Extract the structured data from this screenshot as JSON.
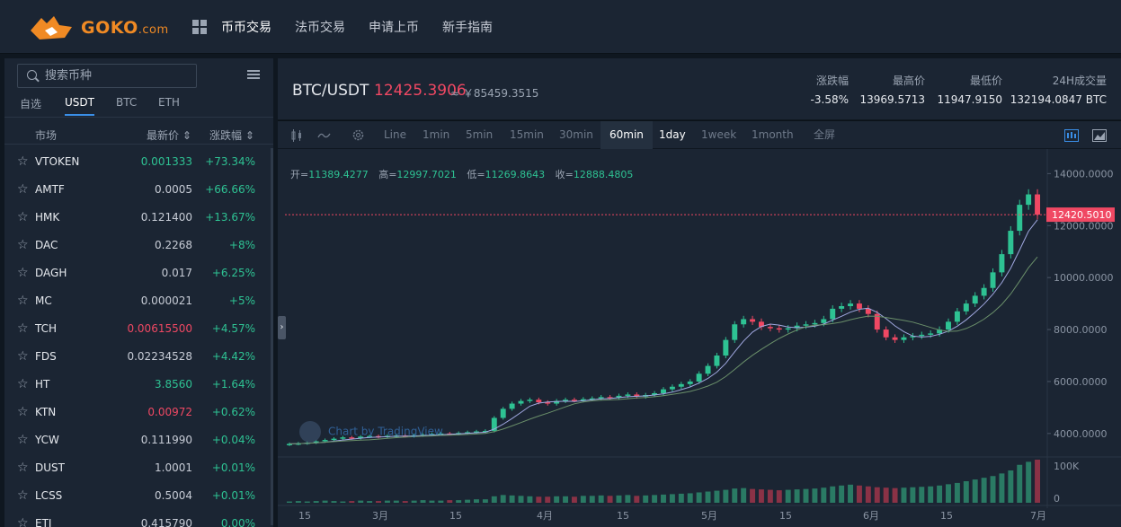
{
  "header": {
    "logo_text": "GOKO",
    "logo_suffix": ".com",
    "nav": [
      "币币交易",
      "法币交易",
      "申请上币",
      "新手指南"
    ]
  },
  "sidebar": {
    "search_placeholder": "搜索币种",
    "tabs": [
      "自选",
      "USDT",
      "BTC",
      "ETH"
    ],
    "columns": {
      "market": "市场",
      "price": "最新价 ⇕",
      "change": "涨跌幅 ⇕"
    },
    "rows": [
      {
        "symbol": "VTOKEN",
        "price": "0.001333",
        "change": "+73.34%",
        "price_color": "green"
      },
      {
        "symbol": "AMTF",
        "price": "0.0005",
        "change": "+66.66%",
        "price_color": "gray"
      },
      {
        "symbol": "HMK",
        "price": "0.121400",
        "change": "+13.67%",
        "price_color": "gray"
      },
      {
        "symbol": "DAC",
        "price": "0.2268",
        "change": "+8%",
        "price_color": "gray"
      },
      {
        "symbol": "DAGH",
        "price": "0.017",
        "change": "+6.25%",
        "price_color": "gray"
      },
      {
        "symbol": "MC",
        "price": "0.000021",
        "change": "+5%",
        "price_color": "gray"
      },
      {
        "symbol": "TCH",
        "price": "0.00615500",
        "change": "+4.57%",
        "price_color": "red"
      },
      {
        "symbol": "FDS",
        "price": "0.02234528",
        "change": "+4.42%",
        "price_color": "gray"
      },
      {
        "symbol": "HT",
        "price": "3.8560",
        "change": "+1.64%",
        "price_color": "green"
      },
      {
        "symbol": "KTN",
        "price": "0.00972",
        "change": "+0.62%",
        "price_color": "red"
      },
      {
        "symbol": "YCW",
        "price": "0.111990",
        "change": "+0.04%",
        "price_color": "gray"
      },
      {
        "symbol": "DUST",
        "price": "1.0001",
        "change": "+0.01%",
        "price_color": "gray"
      },
      {
        "symbol": "LCSS",
        "price": "0.5004",
        "change": "+0.01%",
        "price_color": "gray"
      },
      {
        "symbol": "ETI",
        "price": "0.415790",
        "change": "0.00%",
        "price_color": "gray"
      }
    ]
  },
  "ticker": {
    "pair": "BTC/USDT",
    "price": "12425.3906",
    "cny": "≈ ￥85459.3515",
    "stats": [
      {
        "label": "涨跌幅",
        "value": "-3.58%",
        "color": "red"
      },
      {
        "label": "最高价",
        "value": "13969.5713",
        "color": "white"
      },
      {
        "label": "最低价",
        "value": "11947.9150",
        "color": "white"
      },
      {
        "label": "24H成交量",
        "value": "132194.0847 BTC",
        "color": "white"
      }
    ]
  },
  "toolbar": {
    "intervals": [
      "Line",
      "1min",
      "5min",
      "15min",
      "30min",
      "60min",
      "1day",
      "1week",
      "1month",
      "全屏"
    ],
    "active": "60min",
    "highlight": "1day"
  },
  "ohlc": {
    "open_label": "开=",
    "open": "11389.4277",
    "high_label": "高=",
    "high": "12997.7021",
    "low_label": "低=",
    "low": "11269.8643",
    "close_label": "收=",
    "close": "12888.4805"
  },
  "watermark": "Chart by TradingView",
  "chart_data": {
    "type": "candlestick",
    "y_ticks": [
      "14000.0000",
      "12000.0000",
      "10000.0000",
      "8000.0000",
      "6000.0000",
      "4000.0000"
    ],
    "y_range": [
      3200,
      14600
    ],
    "current_price_label": "12420.5010",
    "current_price": 12420.501,
    "x_ticks": [
      "15",
      "3月",
      "15",
      "4月",
      "15",
      "5月",
      "15",
      "6月",
      "15",
      "7月"
    ],
    "volume_ticks": [
      "100K",
      "0"
    ],
    "price_series": [
      3600,
      3620,
      3650,
      3700,
      3750,
      3800,
      3850,
      3820,
      3880,
      3900,
      3870,
      3910,
      3920,
      3900,
      3930,
      3950,
      3980,
      4000,
      3990,
      4020,
      4050,
      4080,
      4100,
      4600,
      4950,
      5150,
      5250,
      5300,
      5200,
      5150,
      5250,
      5300,
      5280,
      5320,
      5350,
      5400,
      5380,
      5450,
      5500,
      5420,
      5480,
      5550,
      5700,
      5800,
      5900,
      6000,
      6300,
      6600,
      7000,
      7600,
      8200,
      8400,
      8300,
      8100,
      8050,
      8000,
      8050,
      8150,
      8200,
      8250,
      8400,
      8800,
      8900,
      9000,
      8800,
      8600,
      8000,
      7700,
      7600,
      7700,
      7750,
      7800,
      7850,
      8000,
      8300,
      8700,
      9000,
      9300,
      9600,
      10200,
      10900,
      11800,
      12800,
      13200,
      12420
    ],
    "volume_series": [
      3,
      4,
      3,
      4,
      5,
      4,
      3,
      4,
      5,
      4,
      4,
      5,
      5,
      4,
      5,
      6,
      5,
      5,
      6,
      6,
      7,
      8,
      8,
      15,
      18,
      17,
      16,
      15,
      14,
      14,
      15,
      15,
      14,
      16,
      16,
      17,
      16,
      17,
      18,
      16,
      17,
      18,
      19,
      20,
      21,
      22,
      24,
      26,
      28,
      30,
      33,
      34,
      32,
      31,
      30,
      29,
      30,
      31,
      32,
      33,
      35,
      38,
      40,
      42,
      40,
      38,
      36,
      35,
      34,
      35,
      36,
      37,
      38,
      40,
      43,
      46,
      50,
      54,
      58,
      62,
      68,
      75,
      88,
      95,
      100
    ]
  }
}
